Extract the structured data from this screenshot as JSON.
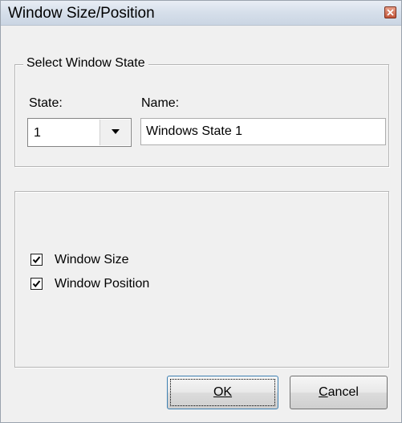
{
  "window": {
    "title": "Window Size/Position"
  },
  "select_state_group": {
    "legend": "Select Window State",
    "state_label": "State:",
    "state_value": "1",
    "name_label": "Name:",
    "name_value": "Windows State 1"
  },
  "options_group": {
    "window_size": {
      "label": "Window Size",
      "checked": true
    },
    "window_position": {
      "label": "Window Position",
      "checked": true
    }
  },
  "buttons": {
    "ok_label": "OK",
    "cancel_label": "Cancel"
  },
  "icons": {
    "close": "close-icon",
    "dropdown": "chevron-down-icon",
    "check": "checkmark-icon"
  }
}
